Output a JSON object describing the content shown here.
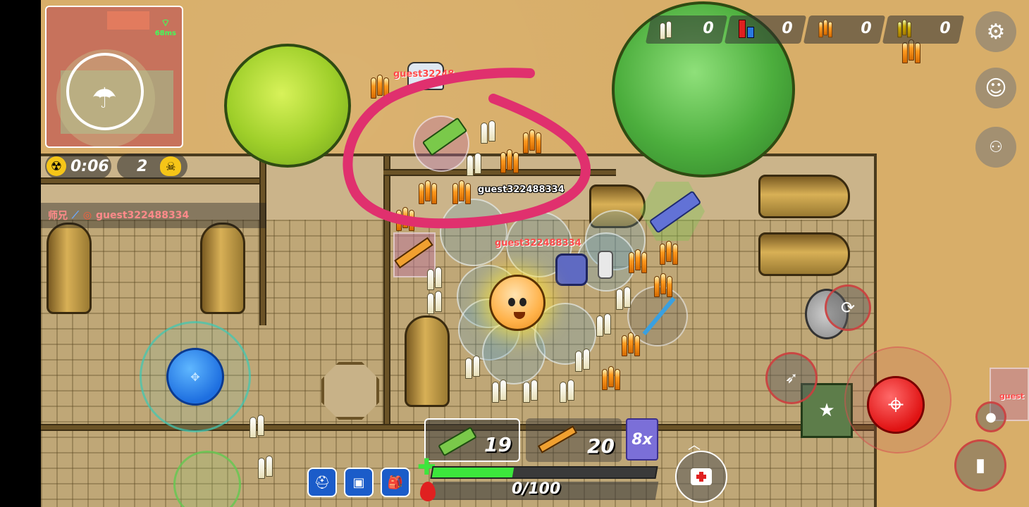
{
  "hud": {
    "ping": "68ms",
    "zone_timer": "0:06",
    "kill_count": "2",
    "killfeed": {
      "killer": "师兄",
      "victim": "guest322488334"
    }
  },
  "resources": [
    {
      "icon": "bullet-white-icon",
      "count": "0"
    },
    {
      "icon": "shell-red-blue-icon",
      "count": "0"
    },
    {
      "icon": "bullet-orange-icon",
      "count": "0"
    },
    {
      "icon": "bullet-gold-icon",
      "count": "0"
    }
  ],
  "players": {
    "self_label": "guest322488334",
    "enemy_label_top": "guest32248",
    "enemy_label_mid": "guest322488334",
    "enemy_label_right": "guest"
  },
  "weapons": {
    "primary_ammo": "19",
    "secondary_ammo": "20",
    "scope": "8x"
  },
  "status": {
    "health_fraction": 0.36,
    "armor": "0/100"
  },
  "colors": {
    "health": "#3ce63c",
    "fire_button": "#e01313",
    "joystick": "#1e6fe0",
    "annotation_stroke": "#e0306e"
  }
}
